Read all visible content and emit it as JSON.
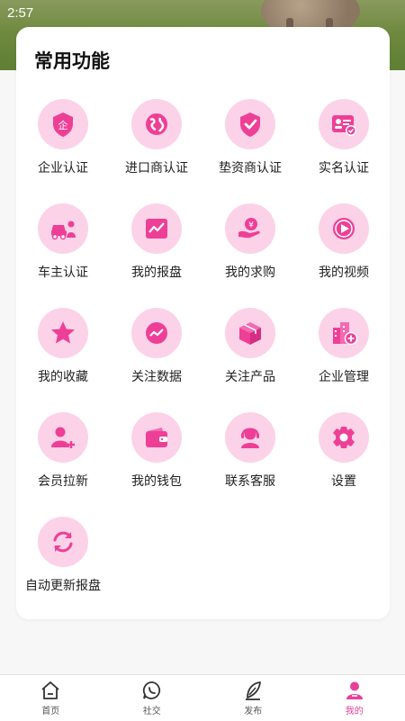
{
  "status_bar": {
    "time": "2:57"
  },
  "card": {
    "title": "常用功能",
    "items": [
      {
        "label": "企业认证",
        "icon": "enterprise-cert-icon"
      },
      {
        "label": "进口商认证",
        "icon": "importer-cert-icon"
      },
      {
        "label": "垫资商认证",
        "icon": "financier-cert-icon"
      },
      {
        "label": "实名认证",
        "icon": "realname-cert-icon"
      },
      {
        "label": "车主认证",
        "icon": "car-owner-cert-icon"
      },
      {
        "label": "我的报盘",
        "icon": "my-offer-chart-icon"
      },
      {
        "label": "我的求购",
        "icon": "my-purchase-icon"
      },
      {
        "label": "我的视频",
        "icon": "video-play-icon"
      },
      {
        "label": "我的收藏",
        "icon": "star-icon"
      },
      {
        "label": "关注数据",
        "icon": "data-trend-icon"
      },
      {
        "label": "关注产品",
        "icon": "product-box-icon"
      },
      {
        "label": "企业管理",
        "icon": "building-plus-icon"
      },
      {
        "label": "会员拉新",
        "icon": "member-add-icon"
      },
      {
        "label": "我的钱包",
        "icon": "wallet-icon"
      },
      {
        "label": "联系客服",
        "icon": "customer-service-icon"
      },
      {
        "label": "设置",
        "icon": "settings-gear-icon"
      },
      {
        "label": "自动更新报盘",
        "icon": "refresh-icon"
      }
    ]
  },
  "tabbar": {
    "tabs": [
      {
        "label": "首页",
        "icon": "home-icon"
      },
      {
        "label": "社交",
        "icon": "chat-icon"
      },
      {
        "label": "发布",
        "icon": "pen-icon"
      },
      {
        "label": "我的",
        "icon": "profile-icon"
      }
    ],
    "active_index": 3
  },
  "colors": {
    "accent": "#e83f9a",
    "icon_bg": "#fcd2e8",
    "inactive": "#555555"
  }
}
